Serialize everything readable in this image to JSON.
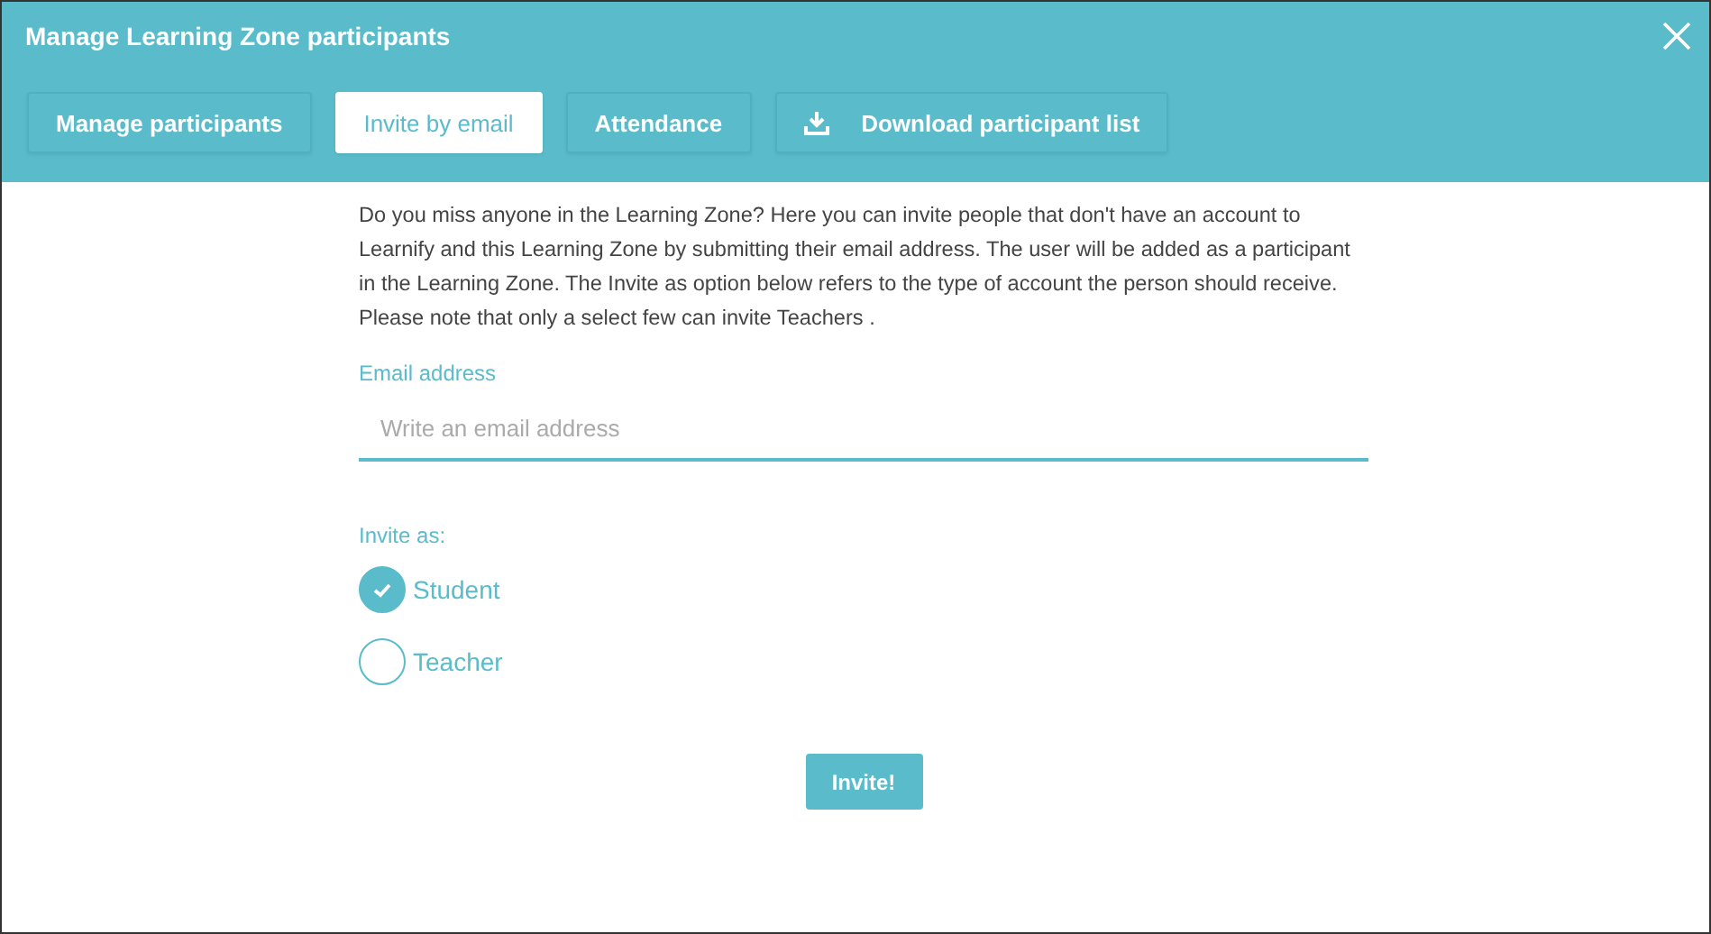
{
  "window": {
    "title": "Manage Learning Zone participants"
  },
  "tabs": [
    {
      "label": "Manage participants",
      "selected": false,
      "kind": "text"
    },
    {
      "label": "Invite by email",
      "selected": true,
      "kind": "text"
    },
    {
      "label": "Attendance",
      "selected": false,
      "kind": "text"
    },
    {
      "label": "Download participant list",
      "selected": false,
      "kind": "download"
    }
  ],
  "intro": "Do you miss anyone in the Learning Zone? Here you can invite people that don't have an account to Learnify and this Learning Zone by submitting their email address. The user will be added as a participant in the Learning Zone. The Invite as option below refers to the type of account the person should receive. Please note that only a select few can invite Teachers .",
  "email": {
    "label": "Email address",
    "placeholder": "Write an email address"
  },
  "role": {
    "label": "Invite as:",
    "options": [
      {
        "label": "Student",
        "selected": true
      },
      {
        "label": "Teacher",
        "selected": false
      }
    ]
  },
  "submit": "Invite!"
}
